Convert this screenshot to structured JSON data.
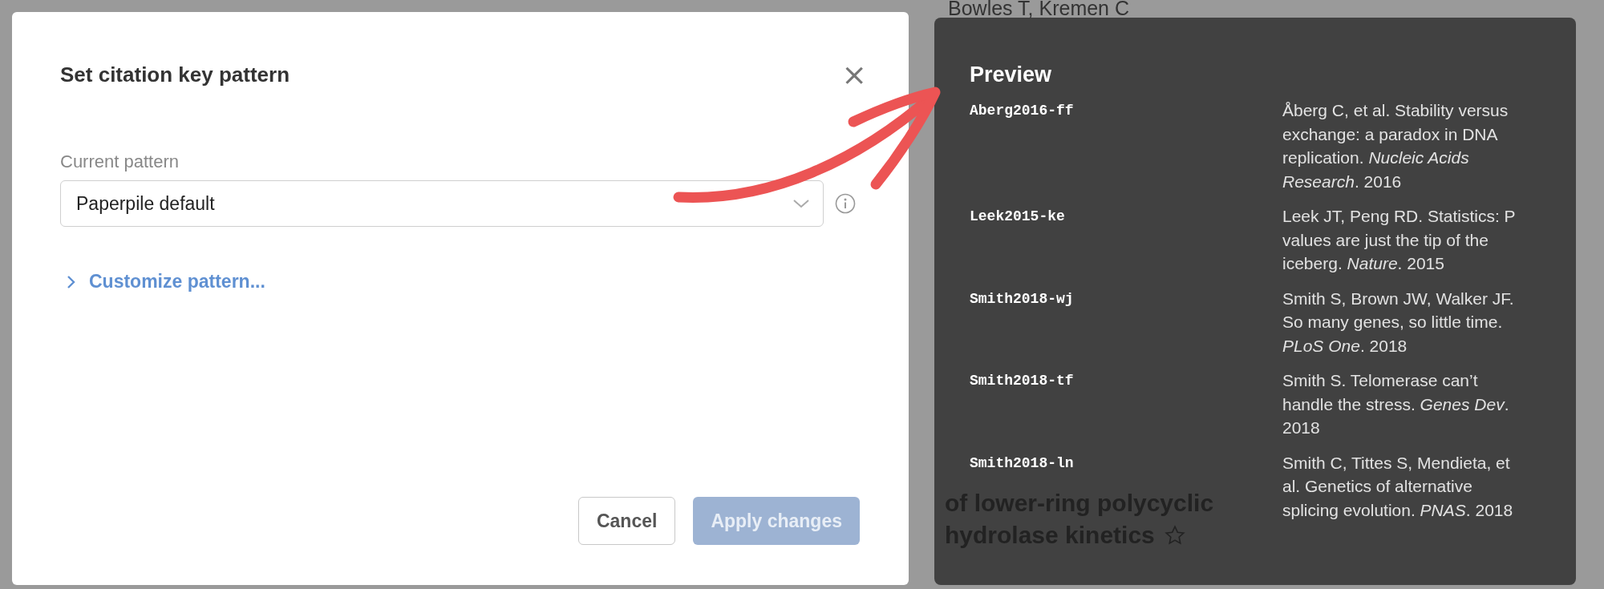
{
  "background_page": {
    "authors": "Bowles T, Kremen C",
    "title_lines": [
      "of lower-ring polycyclic",
      "hydrolase kinetics"
    ]
  },
  "dialog": {
    "title": "Set citation key pattern",
    "close": "×",
    "field_label": "Current pattern",
    "pattern": "Paperpile default",
    "customize_link": "Customize pattern...",
    "buttons": [
      {
        "label": "Cancel",
        "kind": "secondary",
        "disabled": false
      },
      {
        "label": "Apply changes",
        "kind": "primary",
        "disabled": true
      }
    ]
  },
  "preview": {
    "title": "Preview",
    "entries": [
      {
        "key": "Aberg2016-ff",
        "citation": "Åberg C, et al. Stability versus exchange: a paradox in DNA replication. *Nucleic Acids Research*. 2016"
      },
      {
        "key": "Leek2015-ke",
        "citation": "Leek JT, Peng RD. Statistics: P values are just the tip of the iceberg. *Nature*. 2015"
      },
      {
        "key": "Smith2018-wj",
        "citation": "Smith S, Brown JW, Walker JF. So many genes, so little time. *PLoS One*. 2018"
      },
      {
        "key": "Smith2018-tf",
        "citation": "Smith S. Telomerase can’t handle the stress. *Genes Dev*. 2018"
      },
      {
        "key": "Smith2018-ln",
        "citation": "Smith C, Tittes S, Mendieta, et al. Genetics of alternative splicing evolution. *PNAS*. 2018"
      }
    ]
  }
}
